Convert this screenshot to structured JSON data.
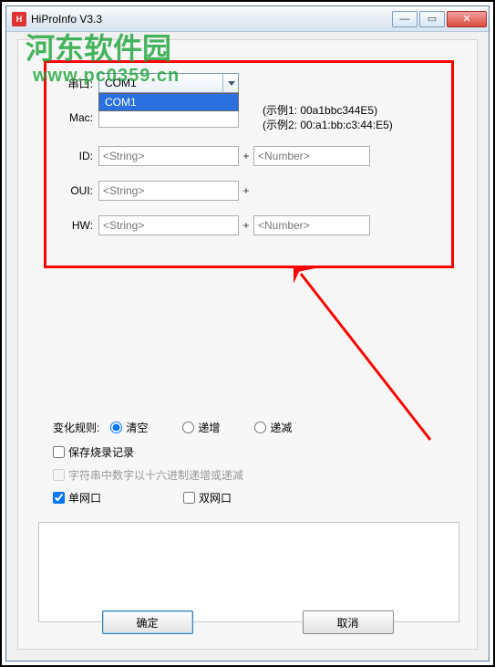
{
  "window": {
    "title": "HiProInfo V3.3",
    "min": "—",
    "max": "▭",
    "close": "✕"
  },
  "watermark": {
    "line1": "河东软件园",
    "line2": "www.pc0359.cn"
  },
  "form": {
    "serial_label": "串口:",
    "serial_value": "COM1",
    "serial_option": "COM1",
    "mac_label": "Mac:",
    "mac_value": "",
    "example1": "(示例1: 00a1bbc344E5)",
    "example2": "(示例2: 00:a1:bb:c3:44:E5)",
    "id_label": "ID:",
    "id_string": "<String>",
    "id_number": "<Number>",
    "oui_label": "OUI:",
    "oui_string": "<String>",
    "hw_label": "HW:",
    "hw_string": "<String>",
    "hw_number": "<Number>",
    "plus": "+"
  },
  "options": {
    "rule_label": "变化规则:",
    "clear": "清空",
    "inc": "递增",
    "dec": "递减",
    "save_record": "保存烧录记录",
    "hex_rule": "字符串中数字以十六进制递增或递减",
    "single_net": "单网口",
    "dual_net": "双网口"
  },
  "buttons": {
    "ok": "确定",
    "cancel": "取消"
  }
}
